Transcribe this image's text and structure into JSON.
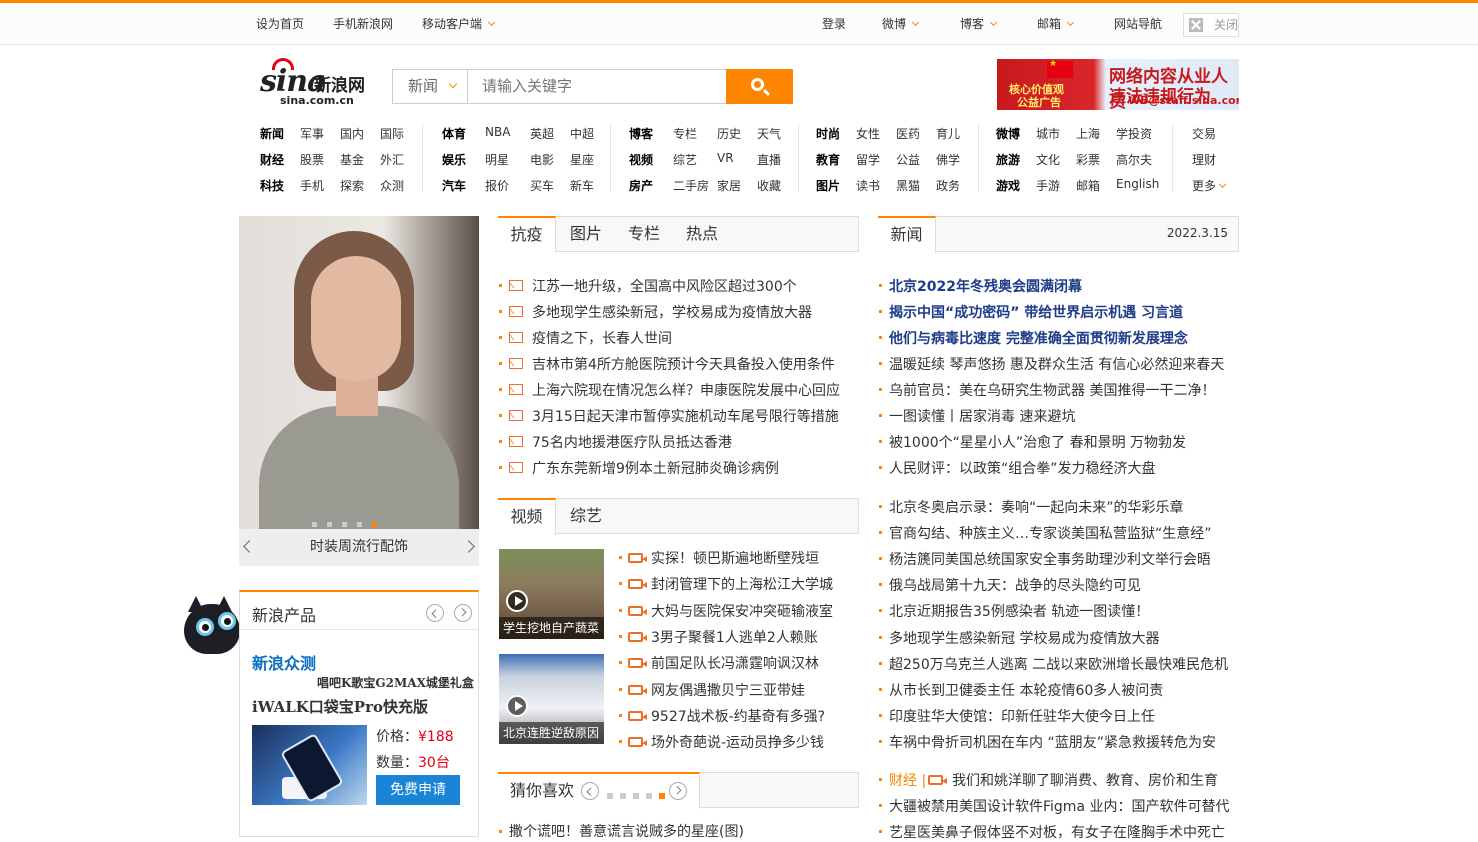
{
  "topbar": {
    "set_home": "设为首页",
    "mobile_sina": "手机新浪网",
    "mobile_client": "移动客户端",
    "login": "登录",
    "weibo": "微博",
    "blog": "博客",
    "mail": "邮箱",
    "site_nav": "网站导航",
    "close": "关闭"
  },
  "logo": {
    "brand": "sina",
    "cn": "新浪网",
    "domain": "sina.com.cn"
  },
  "search": {
    "category": "新闻",
    "placeholder": "请输入关键字"
  },
  "ad": {
    "left1": "核心价值观",
    "left2": "公益广告",
    "right1": "网络内容从业人员",
    "right2": "违法违规行为",
    "right3": "WB@staff.sina.com"
  },
  "nav": {
    "g1": [
      [
        "新闻",
        "军事",
        "国内",
        "国际"
      ],
      [
        "财经",
        "股票",
        "基金",
        "外汇"
      ],
      [
        "科技",
        "手机",
        "探索",
        "众测"
      ]
    ],
    "g2": [
      [
        "体育",
        "NBA",
        "英超",
        "中超"
      ],
      [
        "娱乐",
        "明星",
        "电影",
        "星座"
      ],
      [
        "汽车",
        "报价",
        "买车",
        "新车"
      ]
    ],
    "g3": [
      [
        "博客",
        "专栏",
        "历史",
        "天气"
      ],
      [
        "视频",
        "综艺",
        "VR",
        "直播"
      ],
      [
        "房产",
        "二手房",
        "家居",
        "收藏"
      ]
    ],
    "g4": [
      [
        "时尚",
        "女性",
        "医药",
        "育儿"
      ],
      [
        "教育",
        "留学",
        "公益",
        "佛学"
      ],
      [
        "图片",
        "读书",
        "黑猫",
        "政务"
      ]
    ],
    "g5": [
      [
        "微博",
        "城市",
        "上海",
        "学投资"
      ],
      [
        "旅游",
        "文化",
        "彩票",
        "高尔夫"
      ],
      [
        "游戏",
        "手游",
        "邮箱",
        "English"
      ]
    ],
    "g6": [
      "交易",
      "理财",
      "更多"
    ]
  },
  "hero": {
    "caption": "时装周流行配饰"
  },
  "products": {
    "title": "新浪产品",
    "zhongce": "新浪众测",
    "karaoke": "唱吧K歌宝G2MAX城堡礼盒",
    "iwalk": "iWALK口袋宝Pro快充版",
    "price_label": "价格：",
    "price": "¥188",
    "qty_label": "数量：",
    "qty": "30台",
    "apply": "免费申请"
  },
  "tabs1": [
    "抗疫",
    "图片",
    "专栏",
    "热点"
  ],
  "epidemic_news": [
    "江苏一地升级，全国高中风险区超过300个",
    "多地现学生感染新冠，学校易成为疫情放大器",
    "疫情之下，长春人世间",
    "吉林市第4所方舱医院预计今天具备投入使用条件",
    "上海六院现在情况怎么样？申康医院发展中心回应",
    "3月15日起天津市暂停实施机动车尾号限行等措施",
    "75名内地援港医疗队员抵达香港",
    "广东东莞新增9例本土新冠肺炎确诊病例"
  ],
  "tabs2": [
    "视频",
    "综艺"
  ],
  "videos": {
    "thumb1": "学生挖地自产蔬菜",
    "thumb2": "北京连胜逆敌原因",
    "items": [
      "实探！顿巴斯遍地断壁残垣",
      "封闭管理下的上海松江大学城",
      "大妈与医院保安冲突砸输液室",
      "3男子聚餐1人逃单2人赖账",
      "前国足队长冯潇霆响讽汉林",
      "网友偶遇撒贝宁三亚带娃",
      "9527战术板-约基奇有多强?",
      "场外奇葩说-运动员挣多少钱"
    ]
  },
  "guess": {
    "title": "猜你喜欢",
    "first": "撒个谎吧！善意谎言说贼多的星座(图)"
  },
  "news_tab": {
    "label": "新闻",
    "date": "2022.3.15"
  },
  "news_bold": [
    "北京2022年冬残奥会圆满闭幕",
    "揭示中国“成功密码” 带给世界启示机遇 习言道",
    "他们与病毒比速度 完整准确全面贯彻新发展理念"
  ],
  "news_a": [
    "温暖延续 琴声悠扬 惠及群众生活 有信心必然迎来春天",
    "乌前官员：美在乌研究生物武器 美国推得一干二净！",
    "一图读懂丨居家消毒 速来避坑",
    "被1000个“星星小人”治愈了 春和景明 万物勃发",
    "人民财评：以政策“组合拳”发力稳经济大盘"
  ],
  "news_b": [
    "北京冬奥启示录：奏响“一起向未来”的华彩乐章",
    "官商勾结、种族主义…专家谈美国私营监狱“生意经”",
    "杨洁篪同美国总统国家安全事务助理沙利文举行会晤",
    "俄乌战局第十九天：战争的尽头隐约可见",
    "北京近期报告35例感染者 轨迹一图读懂！",
    "多地现学生感染新冠 学校易成为疫情放大器",
    "超250万乌克兰人逃离 二战以来欧洲增长最快难民危机",
    "从市长到卫健委主任 本轮疫情60多人被问责",
    "印度驻华大使馆：印新任驻华大使今日上任",
    "车祸中骨折司机困在车内 “蓝朋友”紧急救援转危为安"
  ],
  "finance": {
    "tag": "财经 |",
    "item": "我们和姚洋聊了聊消费、教育、房价和生育"
  },
  "news_c": [
    "大疆被禁用美国设计软件Figma 业内：国产软件可替代",
    "艺星医美鼻子假体竖不对板，有女子在隆胸手术中死亡"
  ],
  "colors": {
    "accent": "#ff8400",
    "link_blue": "#0a6ec2",
    "bold_news": "#1f3c8a"
  }
}
